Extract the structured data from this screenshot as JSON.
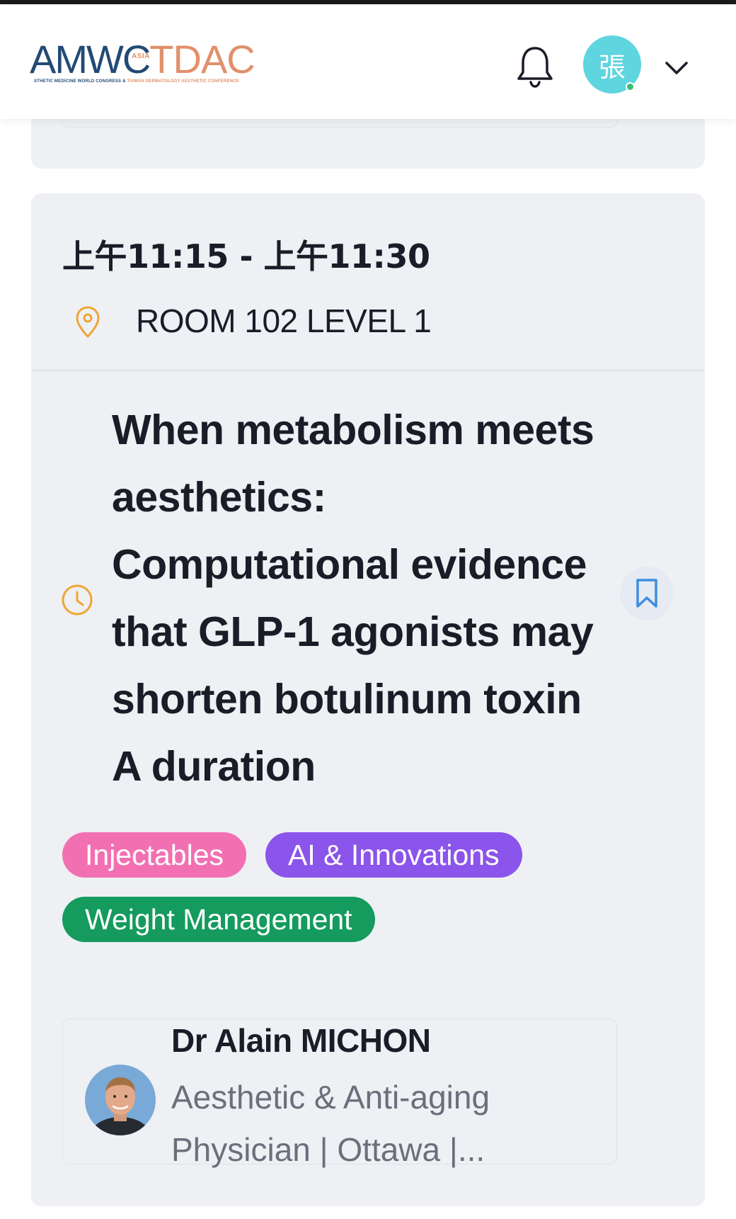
{
  "header": {
    "logo": {
      "primary": "AMWC",
      "region": "ASIA",
      "secondary": "TDAC",
      "tagline_left": "STHETIC MEDICINE WORLD CONGRESS &",
      "tagline_right": "TAIWAN DERMATOLOGY AESTHETIC CONFERENCE"
    },
    "notification_icon": "bell-icon",
    "user_avatar_text": "張",
    "menu_icon": "chevron-down-icon"
  },
  "session": {
    "time_range": "上午11:15 - 上午11:30",
    "location_icon": "map-pin-icon",
    "location": "ROOM 102 LEVEL 1",
    "time_icon": "clock-icon",
    "title": "When metabolism meets aesthetics: Computational evidence that GLP-1 agonists may shorten botulinum toxin A duration",
    "bookmark_icon": "bookmark-icon",
    "tags": [
      {
        "label": "Injectables",
        "color": "#f270b2"
      },
      {
        "label": "AI & Innovations",
        "color": "#8b54ea"
      },
      {
        "label": "Weight Management",
        "color": "#149b5d"
      }
    ],
    "speaker": {
      "name": "Dr Alain MICHON",
      "role": "Aesthetic & Anti-aging Physician | Ottawa |..."
    }
  },
  "colors": {
    "card_bg": "#eef0f4",
    "accent_orange": "#f0a534",
    "bookmark_blue": "#3d8ee0",
    "avatar_bg": "#5fd5e0"
  }
}
